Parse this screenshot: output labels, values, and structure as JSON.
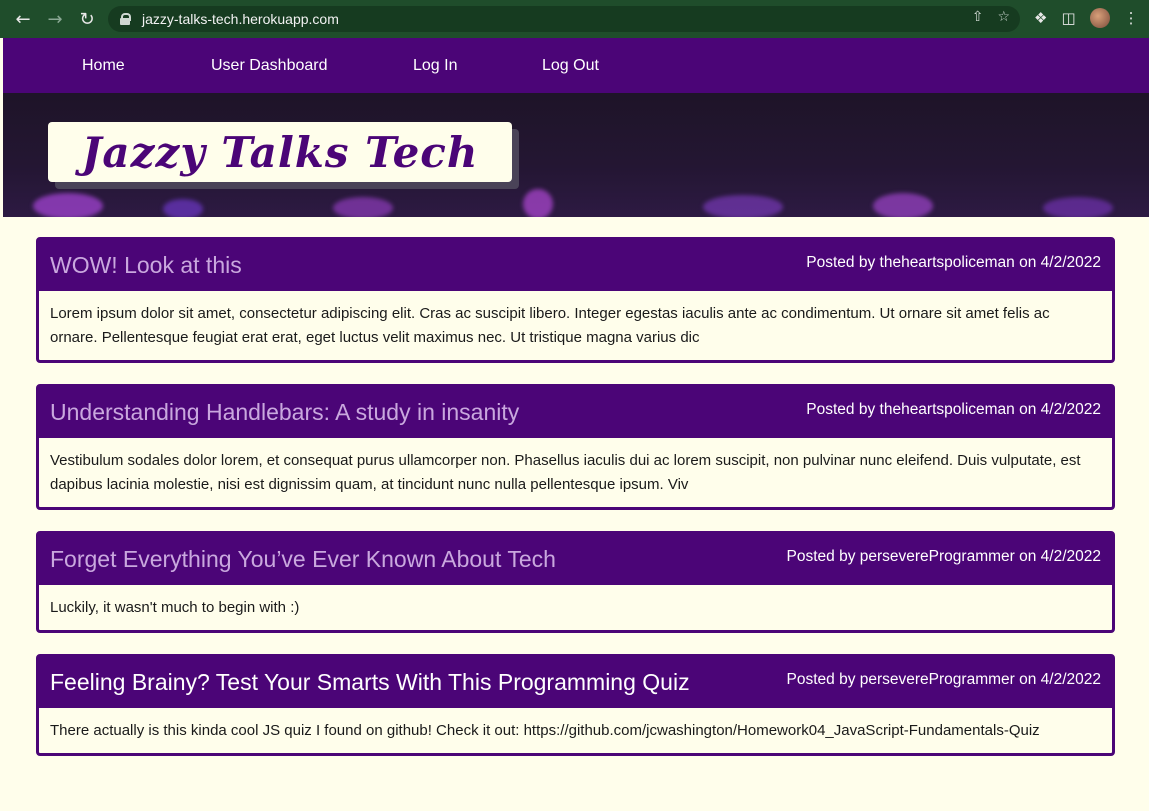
{
  "browser": {
    "url": "jazzy-talks-tech.herokuapp.com"
  },
  "nav": {
    "items": [
      "Home",
      "User Dashboard",
      "Log In",
      "Log Out"
    ]
  },
  "hero": {
    "logo": "Jazzy Talks Tech"
  },
  "posts": [
    {
      "title": "WOW! Look at this",
      "meta": "Posted by theheartspoliceman on 4/2/2022",
      "body": "Lorem ipsum dolor sit amet, consectetur adipiscing elit. Cras ac suscipit libero. Integer egestas iaculis ante ac condimentum. Ut ornare sit amet felis ac ornare. Pellentesque feugiat erat erat, eget luctus velit maximus nec. Ut tristique magna varius dic"
    },
    {
      "title": "Understanding Handlebars: A study in insanity",
      "meta": "Posted by theheartspoliceman on 4/2/2022",
      "body": "Vestibulum sodales dolor lorem, et consequat purus ullamcorper non. Phasellus iaculis dui ac lorem suscipit, non pulvinar nunc eleifend. Duis vulputate, est dapibus lacinia molestie, nisi est dignissim quam, at tincidunt nunc nulla pellentesque ipsum. Viv"
    },
    {
      "title": "Forget Everything You’ve Ever Known About Tech",
      "meta": "Posted by perseverеProgrammer on 4/2/2022",
      "body": "Luckily, it wasn't much to begin with :)"
    },
    {
      "title": "Feeling Brainy? Test Your Smarts With This Programming Quiz",
      "meta": "Posted by perseverеProgrammer on 4/2/2022",
      "body": "There actually is this kinda cool JS quiz I found on github! Check it out: https://github.com/jcwashington/Homework04_JavaScript-Fundamentals-Quiz"
    }
  ],
  "colors": {
    "brand": "#4b0577",
    "background": "#fffeeb",
    "browser_chrome": "#1f4d2b"
  }
}
